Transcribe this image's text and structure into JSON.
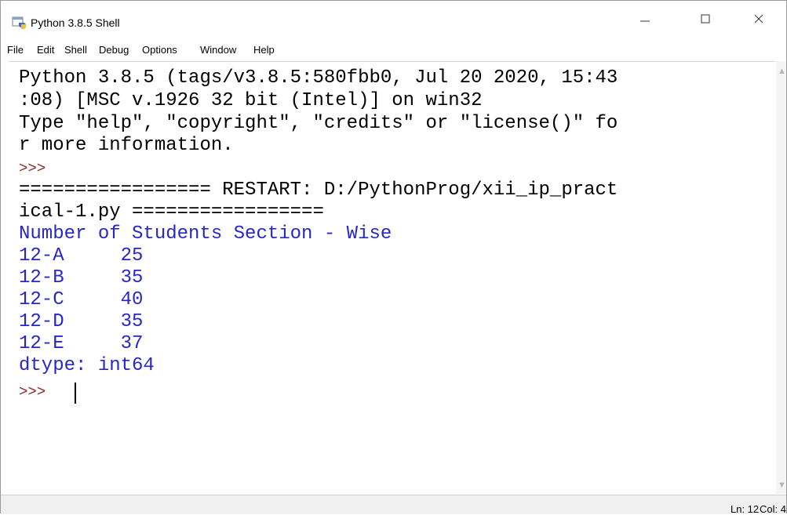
{
  "window": {
    "title": "Python 3.8.5 Shell",
    "controls": {
      "minimize": "—",
      "maximize": "☐",
      "close": "✕"
    }
  },
  "menu": [
    "File",
    "Edit",
    "Shell",
    "Debug",
    "Options",
    "Window",
    "Help"
  ],
  "shell": {
    "lines": [
      "Python 3.8.5 (tags/v3.8.5:580fbb0, Jul 20 2020, 15:43",
      ":08) [MSC v.1926 32 bit (Intel)] on win32",
      "Type \"help\", \"copyright\", \"credits\" or \"license()\" fo",
      "r more information.",
      ">>>",
      "================= RESTART: D:/PythonProg/xii_ip_pract",
      "ical-1.py =================",
      "Number of Students Section - Wise",
      "12-A     25",
      "12-B     35",
      "12-C     40",
      "12-D     35",
      "12-E     37",
      "dtype: int64",
      ">>>"
    ]
  },
  "status": {
    "line": "Ln: 12",
    "col": "Col: 4"
  },
  "icons": {
    "app": "python-idle-icon",
    "scroll_up": "scroll-up-arrow-icon",
    "scroll_down": "scroll-down-arrow-icon"
  },
  "colors": {
    "output_blue": "#2727c9",
    "prompt": "#8a2a2a"
  }
}
